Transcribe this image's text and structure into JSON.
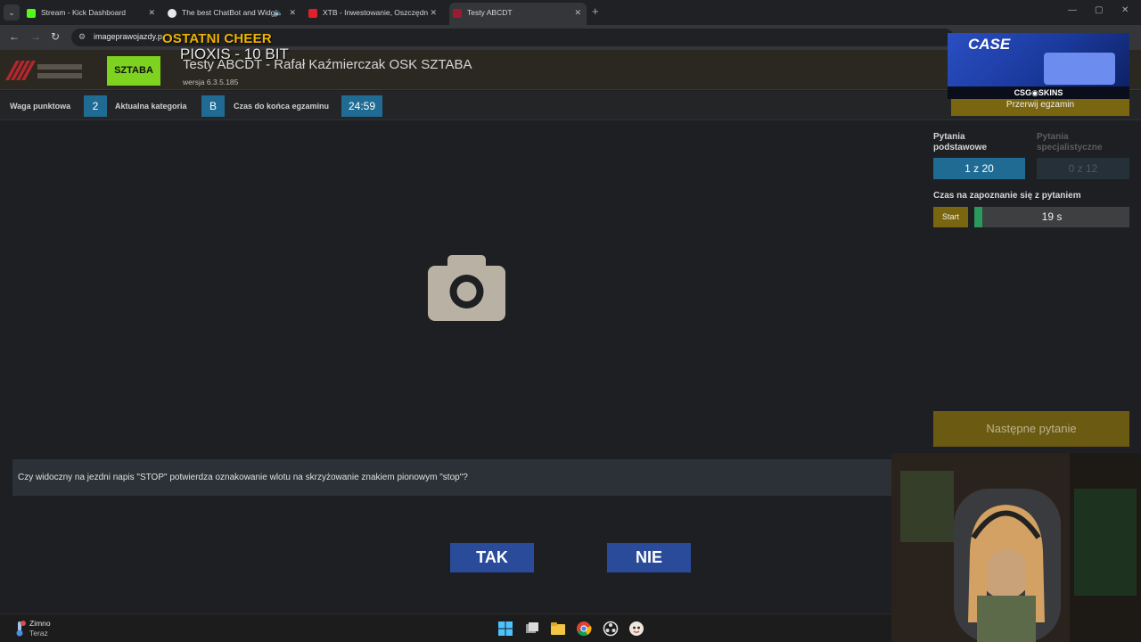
{
  "browser": {
    "tabs": [
      {
        "label": "Stream - Kick Dashboard",
        "color": "#53fc18"
      },
      {
        "label": "The best ChatBot and Widg",
        "color": "#e8e8e8"
      },
      {
        "label": "XTB - Inwestowanie, Oszczędn",
        "color": "#e0212b"
      },
      {
        "label": "Testy ABCDT",
        "color": "#9b1b30"
      }
    ],
    "url": "imageprawojazdy.p"
  },
  "overlay": {
    "cheer_title": "OSTATNI CHEER",
    "cheer_sub": "PIOXIS - 10 BIT"
  },
  "app": {
    "sztaba_logo": "SZTABA",
    "title": "Testy ABCDT - Rafał Kaźmierczak OSK SZTABA",
    "version": "wersja 6.3.5.185"
  },
  "infobar": {
    "weight_label": "Waga punktowa",
    "weight_value": "2",
    "category_label": "Aktualna kategoria",
    "category_value": "B",
    "time_label": "Czas do końca egzaminu",
    "time_value": "24:59"
  },
  "right_panel": {
    "stop_exam": "Przerwij egzamin",
    "basic_head": "Pytania podstawowe",
    "basic_count": "1 z 20",
    "special_head": "Pytania specjalistyczne",
    "special_count": "0 z 12",
    "reading_time_label": "Czas na zapoznanie się z pytaniem",
    "start_label": "Start",
    "timer_value": "19 s",
    "timer_progress": 0.05,
    "next_question": "Następne pytanie"
  },
  "question": {
    "text": "Czy widoczny na jezdni napis \"STOP\" potwierdza oznakowanie wlotu na skrzyżowanie znakiem pionowym \"stop\"?",
    "yes": "TAK",
    "no": "NIE"
  },
  "ad": {
    "case": "CASE",
    "brand": "CSG◉SKINS"
  },
  "taskbar": {
    "weather_temp": "Zimno",
    "weather_time": "Teraz"
  }
}
